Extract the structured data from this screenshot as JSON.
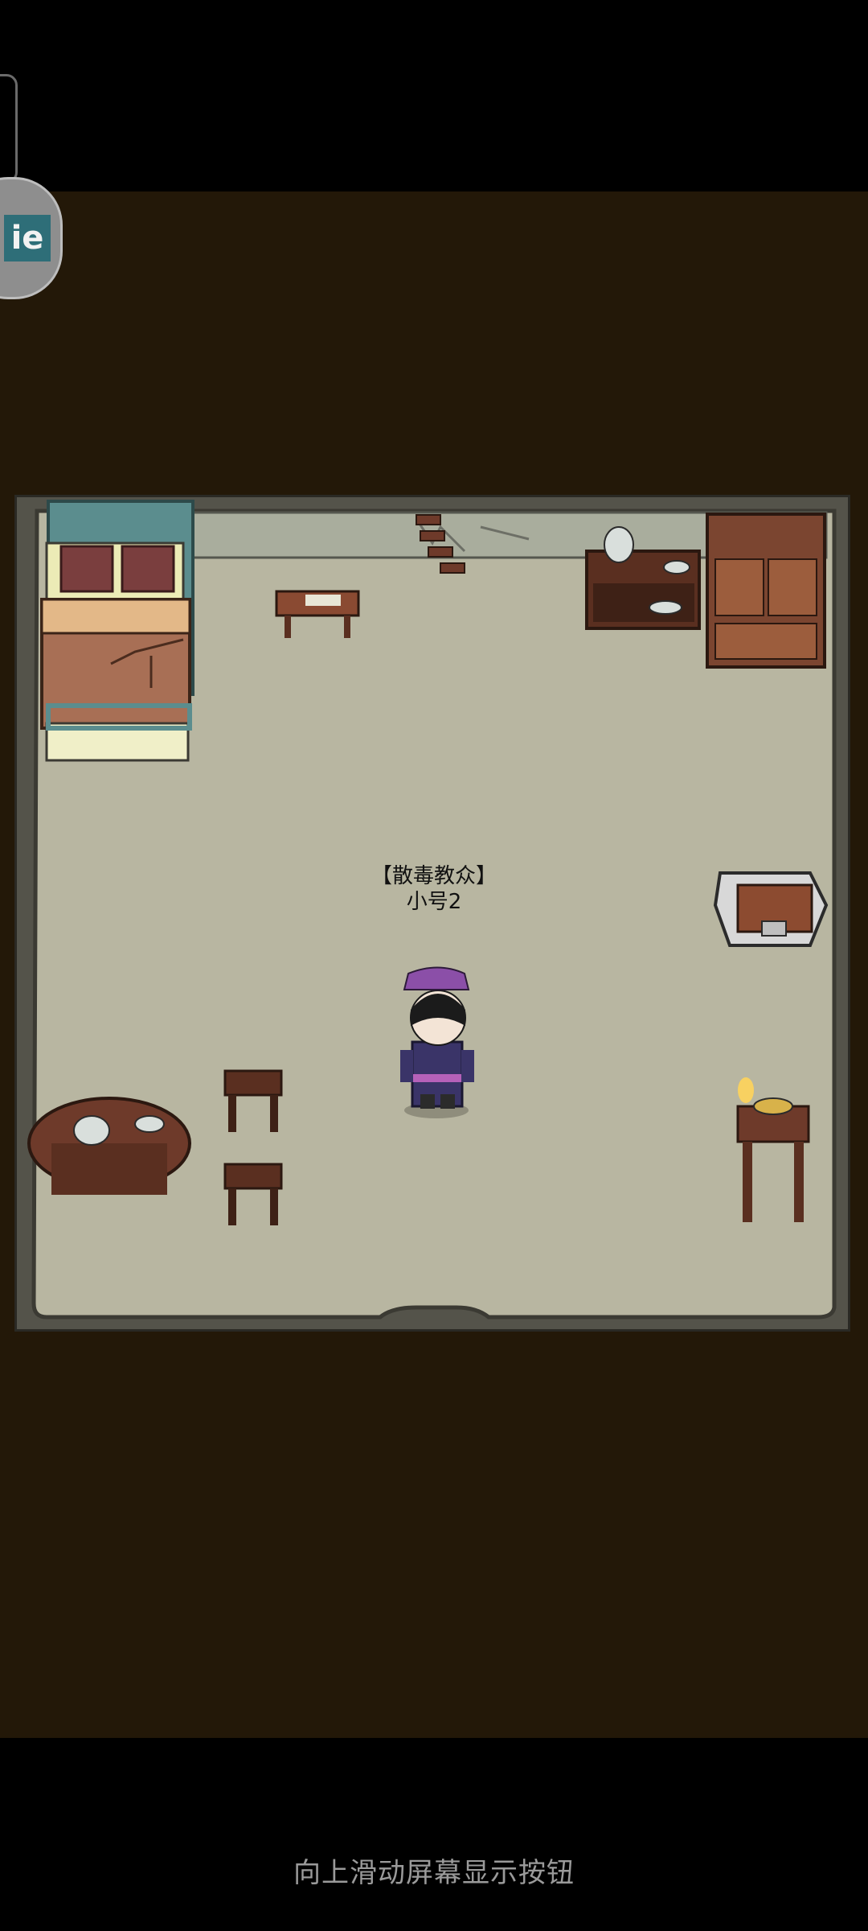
{
  "player": {
    "guild_tag": "【散毒教众】",
    "name": "小号2"
  },
  "hint": {
    "text": "向上滑动屏幕显示按钮"
  },
  "float_button": {
    "icon": "app-logo-icon",
    "label": "ie"
  },
  "colors": {
    "background": "#231808",
    "floor": "#b8b6a1",
    "wall": "#54534a",
    "wood": "#6e3a2a",
    "hint_text": "#9a9a9a"
  }
}
